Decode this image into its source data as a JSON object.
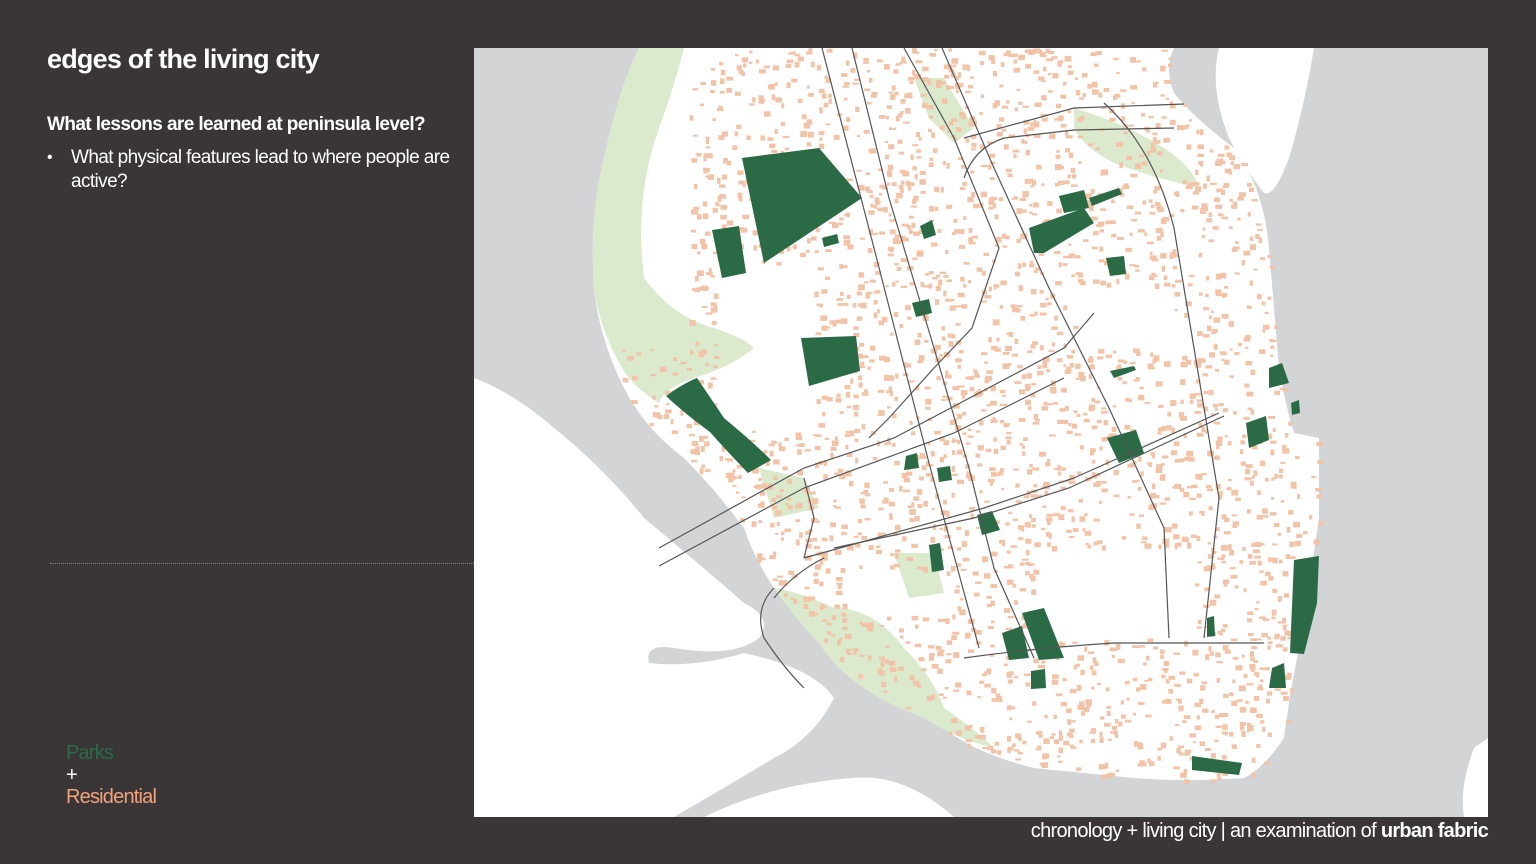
{
  "slide": {
    "title": "edges of the living city",
    "question": "What lessons are learned at peninsula level?",
    "bullets": [
      "What physical features lead to where people are active?"
    ],
    "bullet_symbol": "•"
  },
  "legend": {
    "parks_label": "Parks",
    "plus_label": "+",
    "residential_label": "Residential",
    "parks_color": "#2a6b46",
    "residential_color": "#f0a37c"
  },
  "map": {
    "colors": {
      "water": "#d3d4d5",
      "land": "#ffffff",
      "green_space": "#dbe9cd",
      "parks": "#2a6b46",
      "residential": "#f2c3a7",
      "roads": "#555555"
    }
  },
  "footer": {
    "prefix": "chronology + living city | an examination of ",
    "emphasis": "urban fabric"
  }
}
